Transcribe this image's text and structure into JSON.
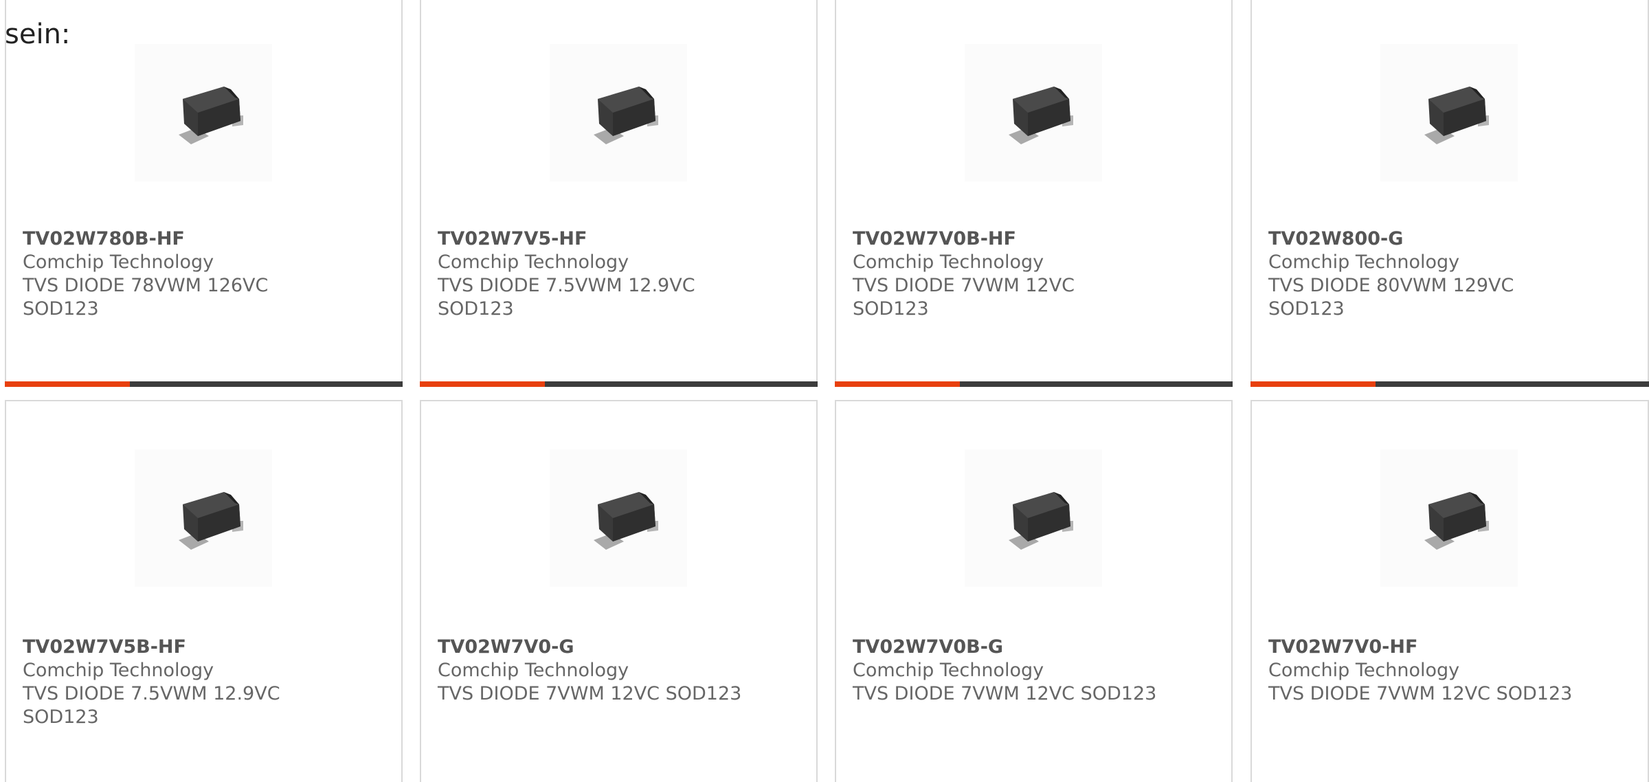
{
  "heading_fragment": "sein:",
  "colors": {
    "accent": "#e8400e",
    "bar": "#3c3c3c",
    "border": "#d9d9d9",
    "text": "#666666",
    "part_text": "#555555"
  },
  "products": [
    {
      "part_number": "TV02W780B-HF",
      "manufacturer": "Comchip Technology",
      "description": "TVS DIODE 78VWM 126VC SOD123",
      "image_icon": "smd-diode-sod123-image"
    },
    {
      "part_number": "TV02W7V5-HF",
      "manufacturer": "Comchip Technology",
      "description": "TVS DIODE 7.5VWM 12.9VC SOD123",
      "image_icon": "smd-diode-sod123-image"
    },
    {
      "part_number": "TV02W7V0B-HF",
      "manufacturer": "Comchip Technology",
      "description": "TVS DIODE 7VWM 12VC SOD123",
      "image_icon": "smd-diode-sod123-image"
    },
    {
      "part_number": "TV02W800-G",
      "manufacturer": "Comchip Technology",
      "description": "TVS DIODE 80VWM 129VC SOD123",
      "image_icon": "smd-diode-sod123-image"
    },
    {
      "part_number": "TV02W7V5B-HF",
      "manufacturer": "Comchip Technology",
      "description": "TVS DIODE 7.5VWM 12.9VC SOD123",
      "image_icon": "smd-diode-sod123-image"
    },
    {
      "part_number": "TV02W7V0-G",
      "manufacturer": "Comchip Technology",
      "description": "TVS DIODE 7VWM 12VC SOD123",
      "image_icon": "smd-diode-sod123-image"
    },
    {
      "part_number": "TV02W7V0B-G",
      "manufacturer": "Comchip Technology",
      "description": "TVS DIODE 7VWM 12VC SOD123",
      "image_icon": "smd-diode-sod123-image"
    },
    {
      "part_number": "TV02W7V0-HF",
      "manufacturer": "Comchip Technology",
      "description": "TVS DIODE 7VWM 12VC SOD123",
      "image_icon": "smd-diode-sod123-image"
    }
  ]
}
